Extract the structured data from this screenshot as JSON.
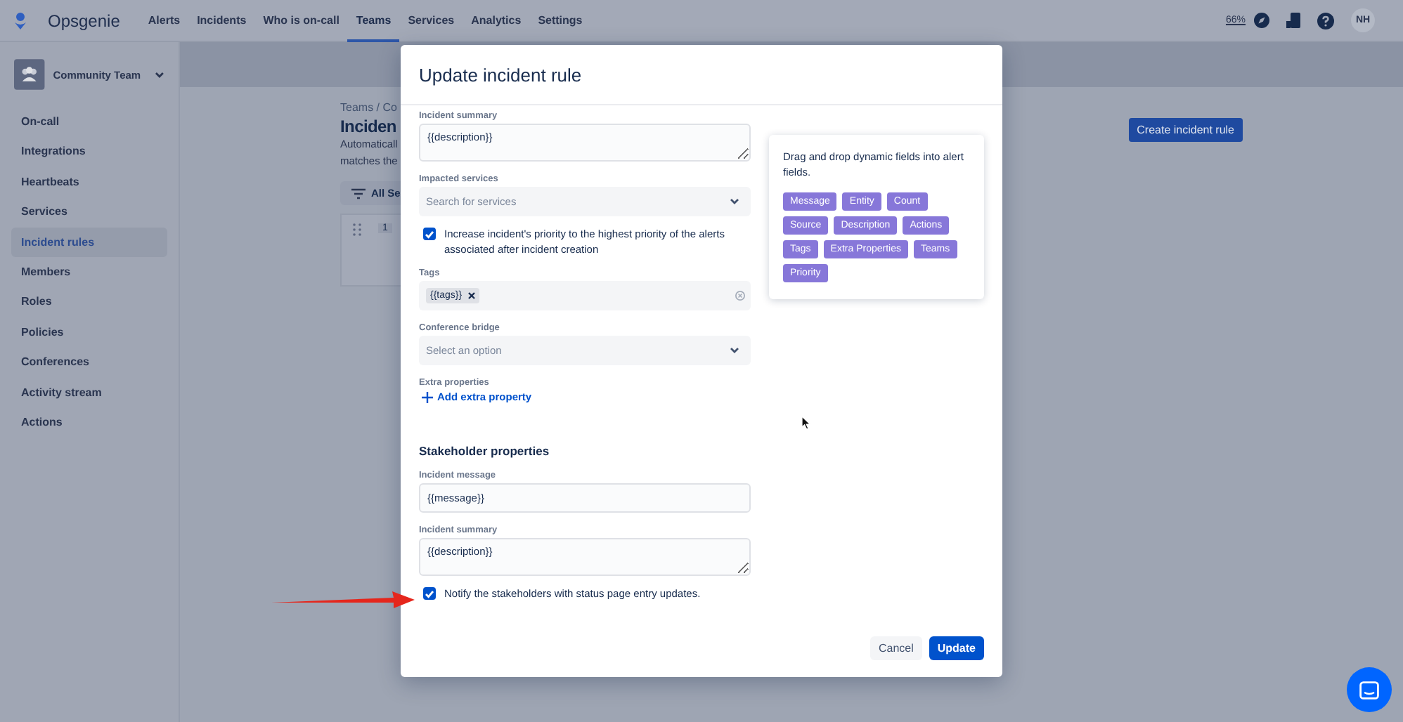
{
  "nav": {
    "logo": "Opsgenie",
    "items": [
      {
        "label": "Alerts",
        "selected": false
      },
      {
        "label": "Incidents",
        "selected": false
      },
      {
        "label": "Who is on-call",
        "selected": false
      },
      {
        "label": "Teams",
        "selected": true
      },
      {
        "label": "Services",
        "selected": false
      },
      {
        "label": "Analytics",
        "selected": false
      },
      {
        "label": "Settings",
        "selected": false
      }
    ],
    "zoom": "66%",
    "avatar": "NH"
  },
  "sidebar": {
    "team": "Community Team",
    "items": [
      {
        "label": "On-call",
        "selected": false
      },
      {
        "label": "Integrations",
        "selected": false
      },
      {
        "label": "Heartbeats",
        "selected": false
      },
      {
        "label": "Services",
        "selected": false
      },
      {
        "label": "Incident rules",
        "selected": true
      },
      {
        "label": "Members",
        "selected": false
      },
      {
        "label": "Roles",
        "selected": false
      },
      {
        "label": "Policies",
        "selected": false
      },
      {
        "label": "Conferences",
        "selected": false
      },
      {
        "label": "Activity stream",
        "selected": false
      },
      {
        "label": "Actions",
        "selected": false
      }
    ]
  },
  "page": {
    "breadcrumb": "Teams / Co",
    "title": "Inciden",
    "description": [
      "Automaticall",
      "matches the"
    ],
    "filter": "All Se",
    "row_number": "1",
    "create_button": "Create incident rule"
  },
  "modal": {
    "title": "Update incident rule",
    "fields": [
      {
        "kind": "textarea",
        "label": "Incident summary",
        "value": "{{description}}"
      },
      {
        "kind": "select",
        "label": "Impacted services",
        "placeholder": "Search for services"
      },
      {
        "kind": "checkbox",
        "label": "Increase incident's priority to the highest priority of the alerts associated after incident creation",
        "checked": true
      },
      {
        "kind": "tags",
        "label": "Tags",
        "tags": [
          "{{tags}}"
        ]
      },
      {
        "kind": "select",
        "label": "Conference bridge",
        "placeholder": "Select an option"
      },
      {
        "kind": "link",
        "label": "Extra properties",
        "link": "Add extra property"
      },
      {
        "kind": "heading",
        "label": "Stakeholder properties"
      },
      {
        "kind": "input",
        "label": "Incident message",
        "value": "{{message}}"
      },
      {
        "kind": "textarea",
        "label": "Incident summary",
        "value": "{{description}}"
      },
      {
        "kind": "checkbox",
        "label": "Notify the stakeholders with status page entry updates.",
        "checked": true
      }
    ],
    "helper": {
      "text": "Drag and drop dynamic fields into alert fields.",
      "chips": [
        "Message",
        "Entity",
        "Count",
        "Source",
        "Description",
        "Actions",
        "Tags",
        "Extra Properties",
        "Teams",
        "Priority"
      ]
    },
    "buttons": [
      {
        "label": "Cancel",
        "primary": false
      },
      {
        "label": "Update",
        "primary": true
      }
    ]
  }
}
